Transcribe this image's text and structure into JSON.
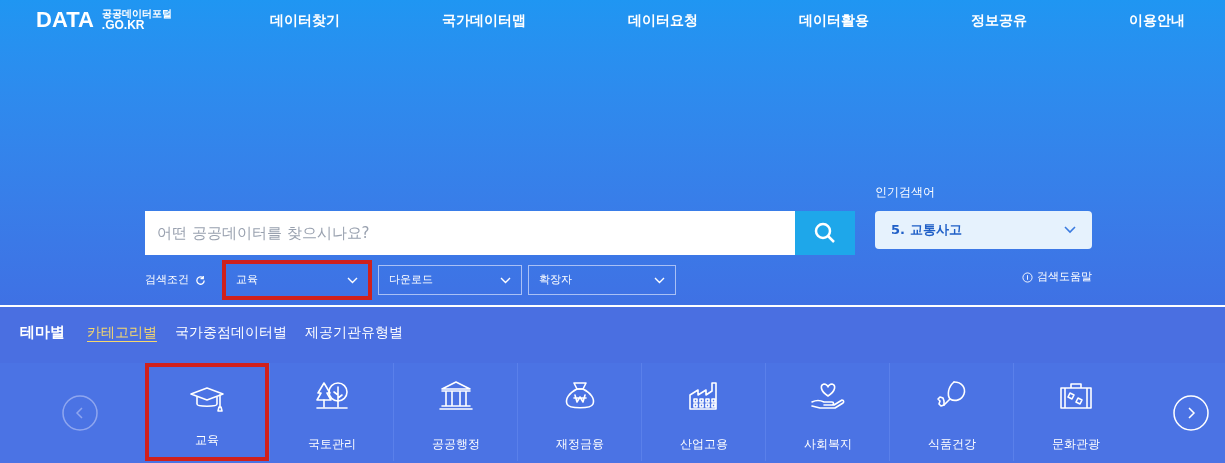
{
  "header": {
    "logo": {
      "text": "DATA",
      "subtitle": "공공데이터포털",
      "domain": ".GO.KR"
    },
    "nav": [
      {
        "label": "데이터찾기"
      },
      {
        "label": "국가데이터맵"
      },
      {
        "label": "데이터요청"
      },
      {
        "label": "데이터활용"
      },
      {
        "label": "정보공유"
      },
      {
        "label": "이용안내"
      }
    ]
  },
  "search": {
    "placeholder": "어떤 공공데이터를 찾으시나요?",
    "popular_label": "인기검색어",
    "popular_value": "5. 교통사고",
    "conditions_label": "검색조건",
    "filters": [
      {
        "value": "교육",
        "highlighted": true
      },
      {
        "value": "다운로드",
        "highlighted": false
      },
      {
        "value": "확장자",
        "highlighted": false
      }
    ],
    "help": "검색도움말"
  },
  "theme": {
    "title": "테마별",
    "tabs": [
      {
        "label": "카테고리별",
        "selected": true
      },
      {
        "label": "국가중점데이터별",
        "selected": false
      },
      {
        "label": "제공기관유형별",
        "selected": false
      }
    ],
    "categories": [
      {
        "kind": "education",
        "label": "교육",
        "highlighted": true
      },
      {
        "kind": "land",
        "label": "국토관리",
        "highlighted": false
      },
      {
        "kind": "admin",
        "label": "공공행정",
        "highlighted": false
      },
      {
        "kind": "finance",
        "label": "재정금융",
        "highlighted": false
      },
      {
        "kind": "industry",
        "label": "산업고용",
        "highlighted": false
      },
      {
        "kind": "welfare",
        "label": "사회복지",
        "highlighted": false
      },
      {
        "kind": "food",
        "label": "식품건강",
        "highlighted": false
      },
      {
        "kind": "culture",
        "label": "문화관광",
        "highlighted": false
      }
    ]
  }
}
